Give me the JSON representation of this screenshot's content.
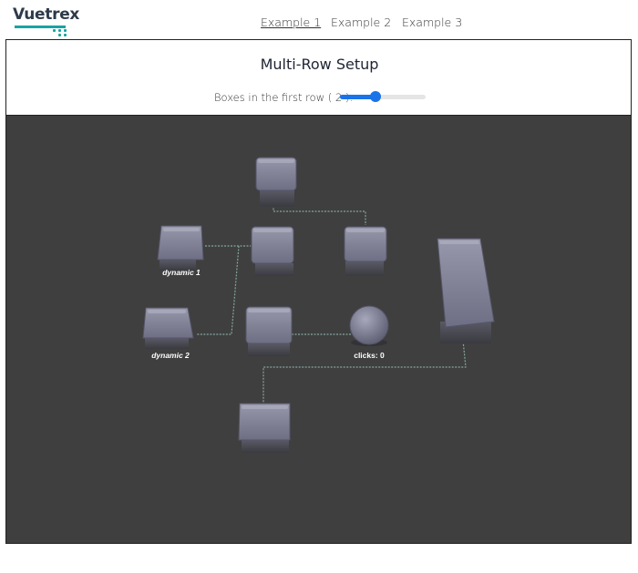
{
  "brand": {
    "name": "Vuetrex"
  },
  "nav": [
    {
      "label": "Example 1",
      "active": true
    },
    {
      "label": "Example 2",
      "active": false
    },
    {
      "label": "Example 3",
      "active": false
    }
  ],
  "page_title": "Multi-Row Setup",
  "slider": {
    "label": "Boxes in the first row ( 2 ):",
    "value": 2,
    "fraction": 0.4
  },
  "scene": {
    "labels": {
      "dynamic1": "dynamic 1",
      "dynamic2": "dynamic 2",
      "clicks": "clicks: 0"
    }
  },
  "colors": {
    "accent": "#1a73e8",
    "brand": "#18a3a3",
    "scene_bg": "#3f3f3f",
    "box": "#7a7a90"
  }
}
